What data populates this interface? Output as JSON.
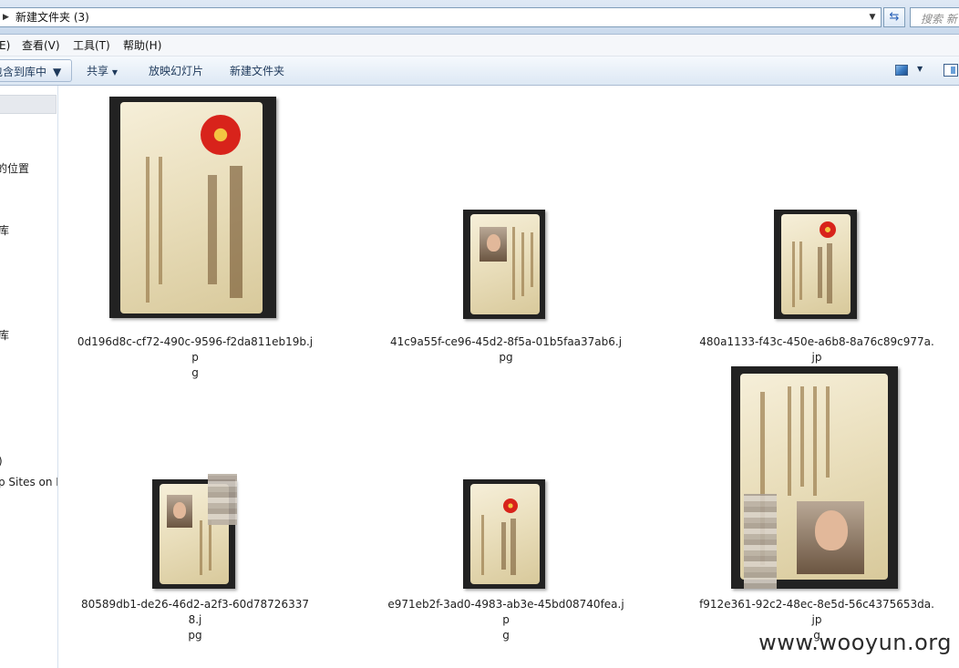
{
  "window": {
    "address_path": "新建文件夹 (3)",
    "search_placeholder": "搜索 新"
  },
  "menu": {
    "items": [
      "E)",
      "查看(V)",
      "工具(T)",
      "帮助(H)"
    ]
  },
  "commandbar": {
    "library_label": "包含到库中",
    "share_label": "共享",
    "slideshow_label": "放映幻灯片",
    "new_folder_label": "新建文件夹"
  },
  "nav": {
    "items": [
      "的位置",
      "库",
      "库",
      ")",
      "p Sites on M"
    ]
  },
  "files": [
    {
      "name_line1": "0d196d8c-cf72-490c-9596-f2da811eb19b.jp",
      "name_line2": "g"
    },
    {
      "name_line1": "41c9a55f-ce96-45d2-8f5a-01b5faa37ab6.jpg",
      "name_line2": ""
    },
    {
      "name_line1": "480a1133-f43c-450e-a6b8-8a76c89c977a.jp",
      "name_line2": "g"
    },
    {
      "name_line1": "80589db1-de26-46d2-a2f3-60d787263378.j",
      "name_line2": "pg"
    },
    {
      "name_line1": "e971eb2f-3ad0-4983-ab3e-45bd08740fea.jp",
      "name_line2": "g"
    },
    {
      "name_line1": "f912e361-92c2-48ec-8e5d-56c4375653da.jp",
      "name_line2": "g"
    }
  ],
  "watermark": "www.wooyun.org"
}
